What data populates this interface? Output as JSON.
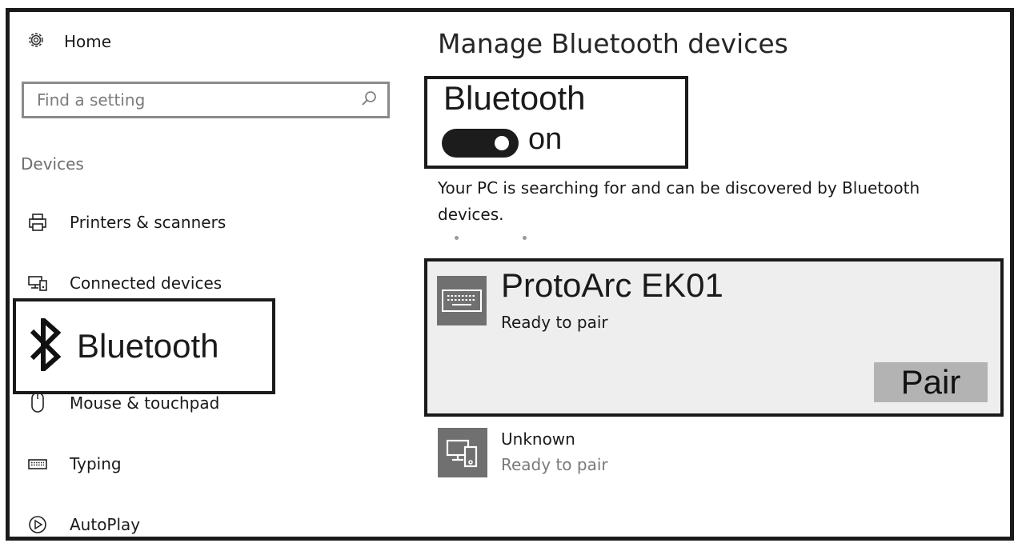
{
  "sidebar": {
    "home_label": "Home",
    "search_placeholder": "Find a setting",
    "section_title": "Devices",
    "items": [
      {
        "label": "Printers & scanners",
        "icon": "printer-icon"
      },
      {
        "label": "Connected devices",
        "icon": "connected-devices-icon"
      },
      {
        "label": "Bluetooth",
        "icon": "bluetooth-icon",
        "selected": true
      },
      {
        "label": "Mouse & touchpad",
        "icon": "mouse-icon"
      },
      {
        "label": "Typing",
        "icon": "keyboard-icon"
      },
      {
        "label": "AutoPlay",
        "icon": "autoplay-icon"
      }
    ]
  },
  "main": {
    "title": "Manage Bluetooth devices",
    "bluetooth": {
      "label": "Bluetooth",
      "state": "on",
      "enabled": true
    },
    "status_text": "Your PC is searching for and can be discovered by Bluetooth devices.",
    "devices": [
      {
        "name": "ProtoArc EK01",
        "status": "Ready to pair",
        "icon": "keyboard-device-icon",
        "action": "Pair",
        "selected": true
      },
      {
        "name": "Unknown",
        "status": "Ready to pair",
        "icon": "pc-phone-device-icon"
      }
    ]
  },
  "colors": {
    "frame": "#1a1a1a",
    "toggle_on": "#1c1c1c",
    "card_bg": "#eeeeee",
    "pair_button": "#b3b3b3",
    "device_icon_bg": "#707070",
    "secondary_text": "#7a7a7a"
  }
}
